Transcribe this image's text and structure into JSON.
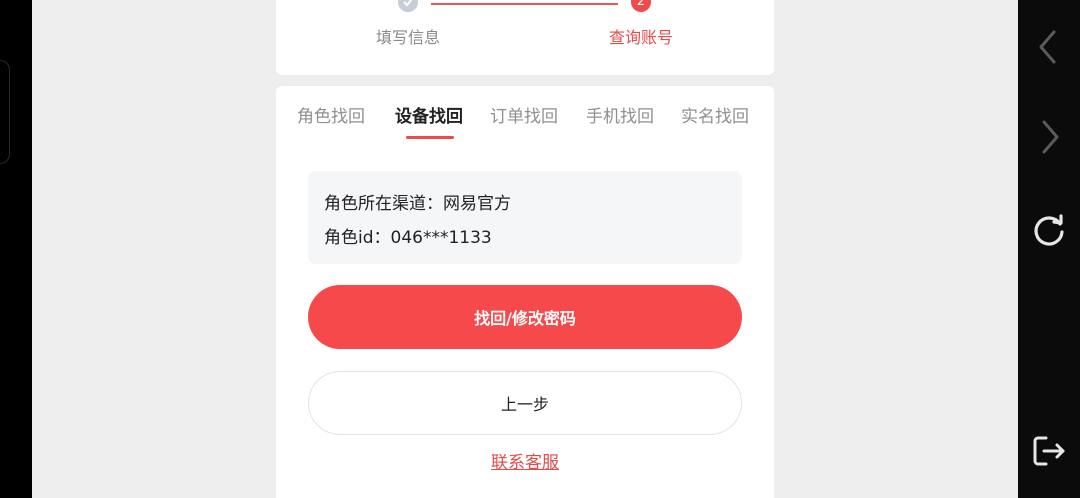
{
  "steps": [
    {
      "label": "填写信息",
      "state": "done"
    },
    {
      "label": "查询账号",
      "number": "2",
      "state": "active"
    }
  ],
  "tabs": [
    {
      "label": "角色找回",
      "active": false
    },
    {
      "label": "设备找回",
      "active": true
    },
    {
      "label": "订单找回",
      "active": false
    },
    {
      "label": "手机找回",
      "active": false
    },
    {
      "label": "实名找回",
      "active": false
    }
  ],
  "info": {
    "channel_line": "角色所在渠道：网易官方",
    "role_id_line": "角色id：046***1133"
  },
  "actions": {
    "primary_label": "找回/修改密码",
    "back_label": "上一步",
    "service_link": "联系客服"
  },
  "nav_bar": {
    "icons": [
      "chevron-left-icon",
      "chevron-right-icon",
      "refresh-icon",
      "exit-icon"
    ]
  },
  "colors": {
    "accent": "#f6494b",
    "step_line": "#e95555",
    "background": "#eeeeef"
  }
}
